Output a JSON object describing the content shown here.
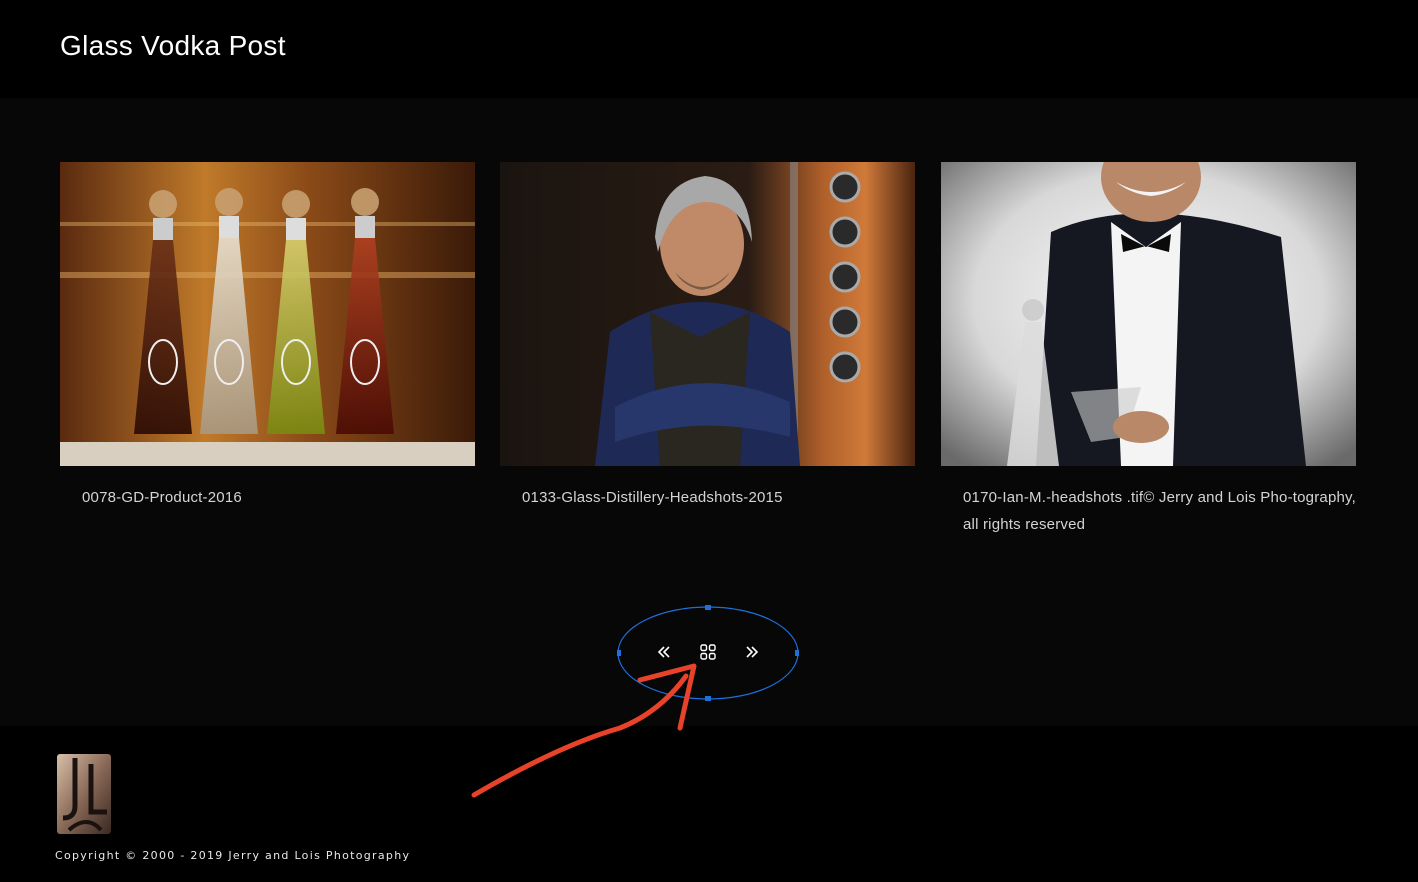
{
  "header": {
    "title": "Glass Vodka Post"
  },
  "gallery": [
    {
      "caption": "0078-GD-Product-2016"
    },
    {
      "caption": "0133-Glass-Distillery-Headshots-2015"
    },
    {
      "caption": "0170-Ian-M.-headshots .tif© Jerry and Lois Pho-tography, all rights reserved"
    }
  ],
  "pager": {
    "prev_icon": "double-chevron-left-icon",
    "grid_icon": "grid-icon",
    "next_icon": "double-chevron-right-icon"
  },
  "footer": {
    "copyright": "Copyright © 2000 - 2019 Jerry and Lois Photography"
  },
  "colors": {
    "annotation_ellipse": "#1e6fd9",
    "annotation_arrow": "#e8432a",
    "page_bg": "#070707"
  }
}
